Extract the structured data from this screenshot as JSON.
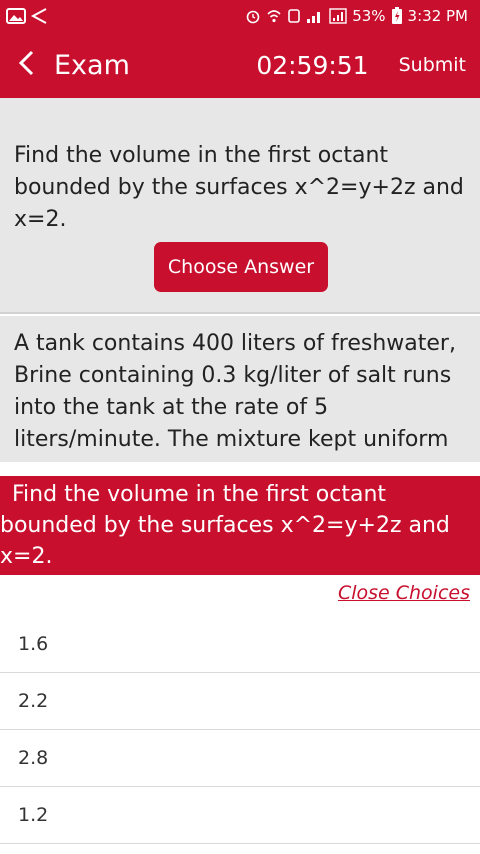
{
  "status_bar": {
    "battery": "53%",
    "time": "3:32 PM"
  },
  "appbar": {
    "title": "Exam",
    "timer": "02:59:51",
    "submit_label": "Submit"
  },
  "questions": [
    {
      "text": "Find the volume in the first octant bounded by the surfaces x^2=y+2z and x=2.",
      "button_label": "Choose Answer"
    },
    {
      "text": "A tank contains 400 liters of freshwater, Brine containing 0.3 kg/liter of salt runs into the tank at the rate of 5 liters/minute. The mixture kept uniform"
    }
  ],
  "choices_panel": {
    "question": "Find the volume in the first octant bounded by the surfaces x^2=y+2z and x=2.",
    "close_label": "Close Choices",
    "options": [
      "1.6",
      "2.2",
      "2.8",
      "1.2"
    ]
  },
  "colors": {
    "accent": "#c8102e",
    "card_bg": "#e7e7e7"
  }
}
